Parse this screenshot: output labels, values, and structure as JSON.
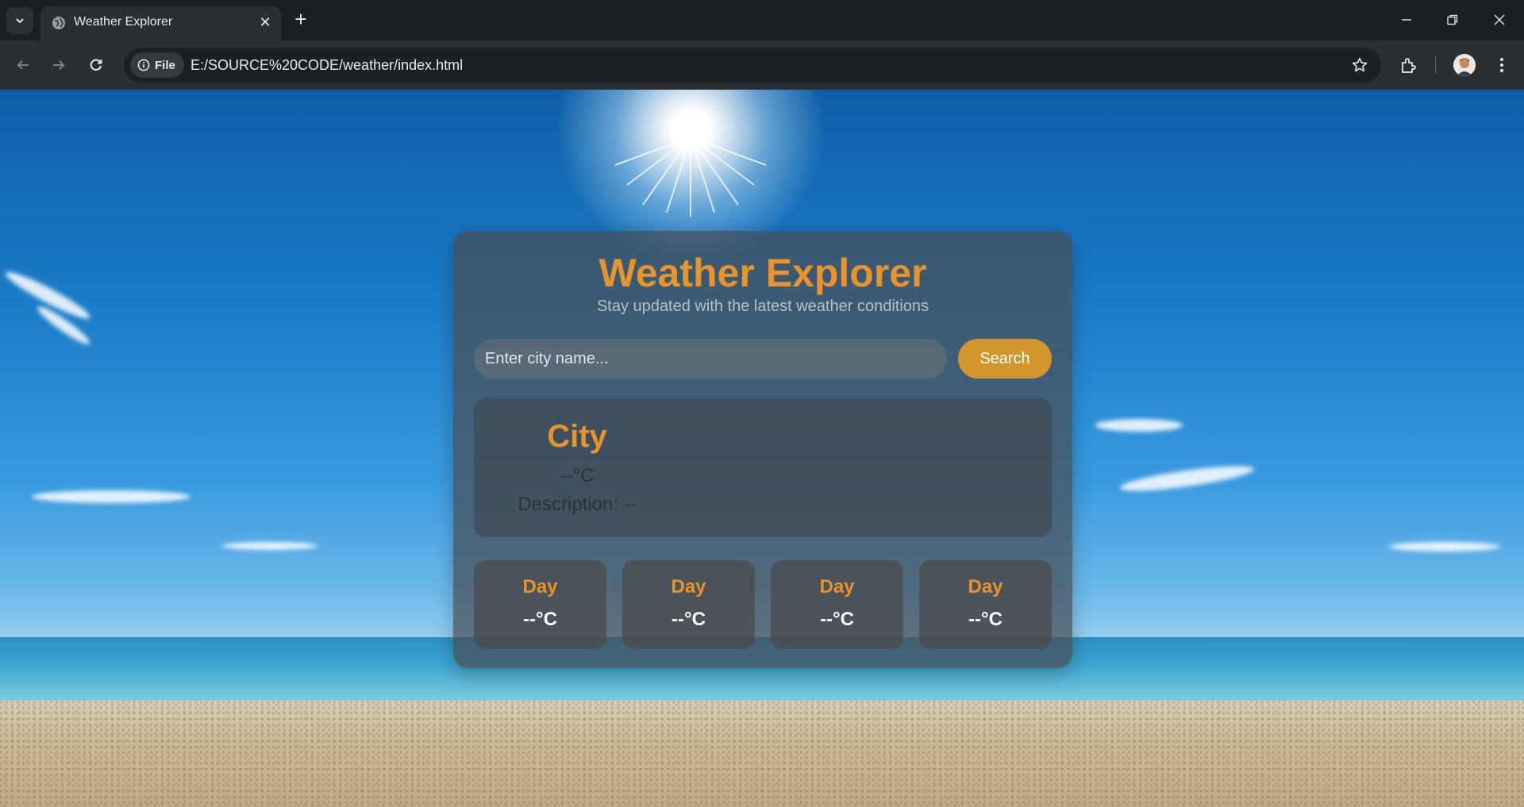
{
  "browser": {
    "tab_title": "Weather Explorer",
    "address_chip": "File",
    "url": "E:/SOURCE%20CODE/weather/index.html"
  },
  "app": {
    "title": "Weather Explorer",
    "subtitle": "Stay updated with the latest weather conditions",
    "search_placeholder": "Enter city name...",
    "search_button": "Search"
  },
  "current": {
    "city": "City",
    "temperature": "--°C",
    "description": "Description: --"
  },
  "forecast": [
    {
      "day": "Day",
      "temp": "--°C"
    },
    {
      "day": "Day",
      "temp": "--°C"
    },
    {
      "day": "Day",
      "temp": "--°C"
    },
    {
      "day": "Day",
      "temp": "--°C"
    }
  ],
  "colors": {
    "accent": "#e8942a",
    "button": "#d3962f"
  }
}
